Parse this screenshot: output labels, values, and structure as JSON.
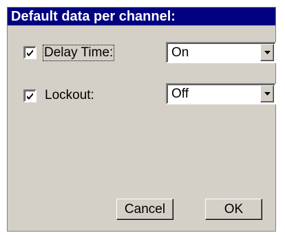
{
  "dialog": {
    "title": "Default data per channel:"
  },
  "options": [
    {
      "label": "Delay Time:",
      "checked": true,
      "value": "On"
    },
    {
      "label": "Lockout:",
      "checked": true,
      "value": "Off"
    }
  ],
  "buttons": {
    "cancel_label": "Cancel",
    "ok_label": "OK"
  },
  "colors": {
    "titlebar": "#000080",
    "face": "#d4d0c8"
  }
}
